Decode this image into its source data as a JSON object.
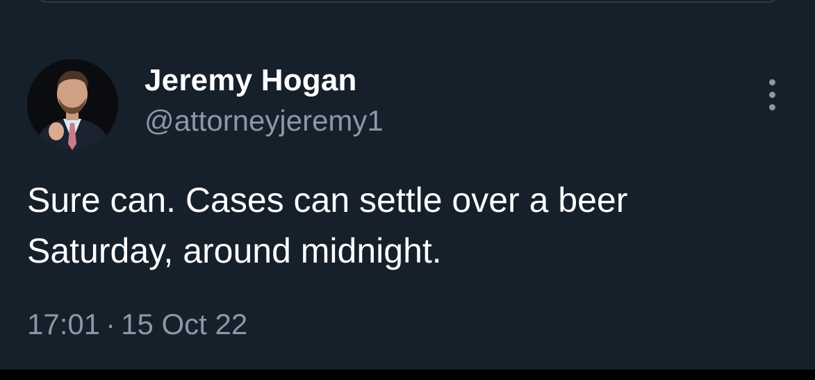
{
  "tweet": {
    "author": {
      "name": "Jeremy Hogan",
      "handle": "@attorneyjeremy1"
    },
    "text": "Sure can. Cases can settle over a beer\nSaturday, around midnight.",
    "time": "17:01",
    "separator": "·",
    "date": "15 Oct 22"
  },
  "icons": {
    "more": "more-vertical-icon"
  },
  "colors": {
    "background": "#15202b",
    "primary_text": "#ffffff",
    "secondary_text": "#8b98a5"
  }
}
